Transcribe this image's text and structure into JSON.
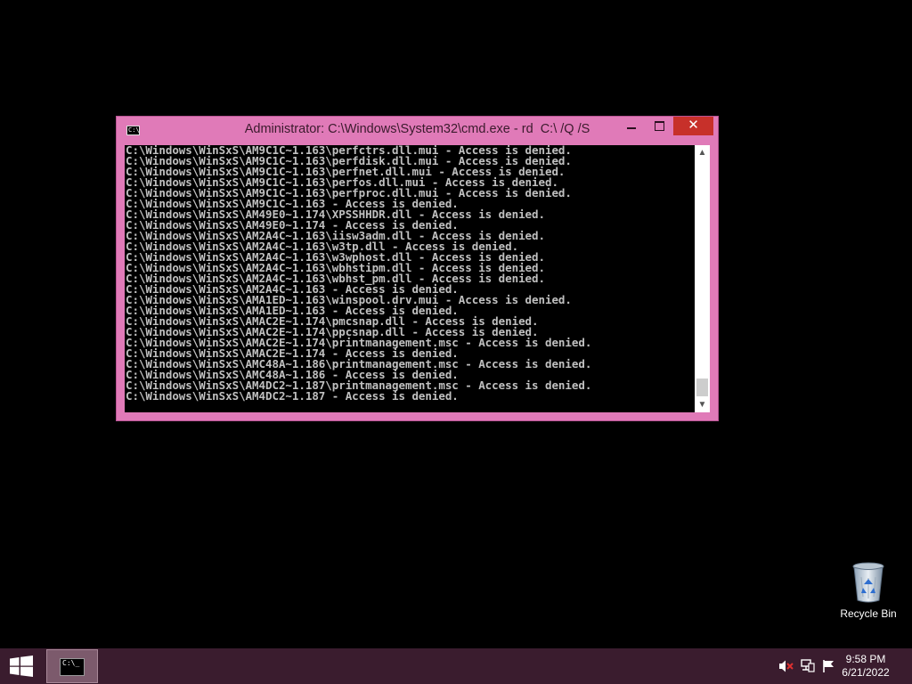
{
  "window": {
    "title": "Administrator: C:\\Windows\\System32\\cmd.exe - rd  C:\\ /Q /S",
    "icon_label": "C:\\",
    "minimize_glyph": "",
    "close_glyph": "✕",
    "console_lines": [
      "C:\\Windows\\WinSxS\\AM9C1C~1.163\\perfctrs.dll.mui - Access is denied.",
      "C:\\Windows\\WinSxS\\AM9C1C~1.163\\perfdisk.dll.mui - Access is denied.",
      "C:\\Windows\\WinSxS\\AM9C1C~1.163\\perfnet.dll.mui - Access is denied.",
      "C:\\Windows\\WinSxS\\AM9C1C~1.163\\perfos.dll.mui - Access is denied.",
      "C:\\Windows\\WinSxS\\AM9C1C~1.163\\perfproc.dll.mui - Access is denied.",
      "C:\\Windows\\WinSxS\\AM9C1C~1.163 - Access is denied.",
      "C:\\Windows\\WinSxS\\AM49E0~1.174\\XPSSHHDR.dll - Access is denied.",
      "C:\\Windows\\WinSxS\\AM49E0~1.174 - Access is denied.",
      "C:\\Windows\\WinSxS\\AM2A4C~1.163\\iisw3adm.dll - Access is denied.",
      "C:\\Windows\\WinSxS\\AM2A4C~1.163\\w3tp.dll - Access is denied.",
      "C:\\Windows\\WinSxS\\AM2A4C~1.163\\w3wphost.dll - Access is denied.",
      "C:\\Windows\\WinSxS\\AM2A4C~1.163\\wbhstipm.dll - Access is denied.",
      "C:\\Windows\\WinSxS\\AM2A4C~1.163\\wbhst_pm.dll - Access is denied.",
      "C:\\Windows\\WinSxS\\AM2A4C~1.163 - Access is denied.",
      "C:\\Windows\\WinSxS\\AMA1ED~1.163\\winspool.drv.mui - Access is denied.",
      "C:\\Windows\\WinSxS\\AMA1ED~1.163 - Access is denied.",
      "C:\\Windows\\WinSxS\\AMAC2E~1.174\\pmcsnap.dll - Access is denied.",
      "C:\\Windows\\WinSxS\\AMAC2E~1.174\\ppcsnap.dll - Access is denied.",
      "C:\\Windows\\WinSxS\\AMAC2E~1.174\\printmanagement.msc - Access is denied.",
      "C:\\Windows\\WinSxS\\AMAC2E~1.174 - Access is denied.",
      "C:\\Windows\\WinSxS\\AMC48A~1.186\\printmanagement.msc - Access is denied.",
      "C:\\Windows\\WinSxS\\AMC48A~1.186 - Access is denied.",
      "C:\\Windows\\WinSxS\\AM4DC2~1.187\\printmanagement.msc - Access is denied.",
      "C:\\Windows\\WinSxS\\AM4DC2~1.187 - Access is denied."
    ]
  },
  "desktop": {
    "recycle_bin_label": "Recycle Bin"
  },
  "taskbar": {
    "cmd_icon_label": "C:\\_",
    "clock_time": "9:58 PM",
    "clock_date": "6/21/2022"
  },
  "colors": {
    "window_frame": "#e07ab8",
    "close_button": "#c7302a",
    "taskbar": "#3a1c2e",
    "console_text": "#c0c0c0"
  },
  "icons": [
    "cmd-icon",
    "minimize-icon",
    "maximize-icon",
    "close-icon",
    "scroll-up-icon",
    "scroll-down-icon",
    "recycle-bin-icon",
    "windows-start-icon",
    "speaker-muted-icon",
    "network-icon",
    "action-center-flag-icon"
  ]
}
